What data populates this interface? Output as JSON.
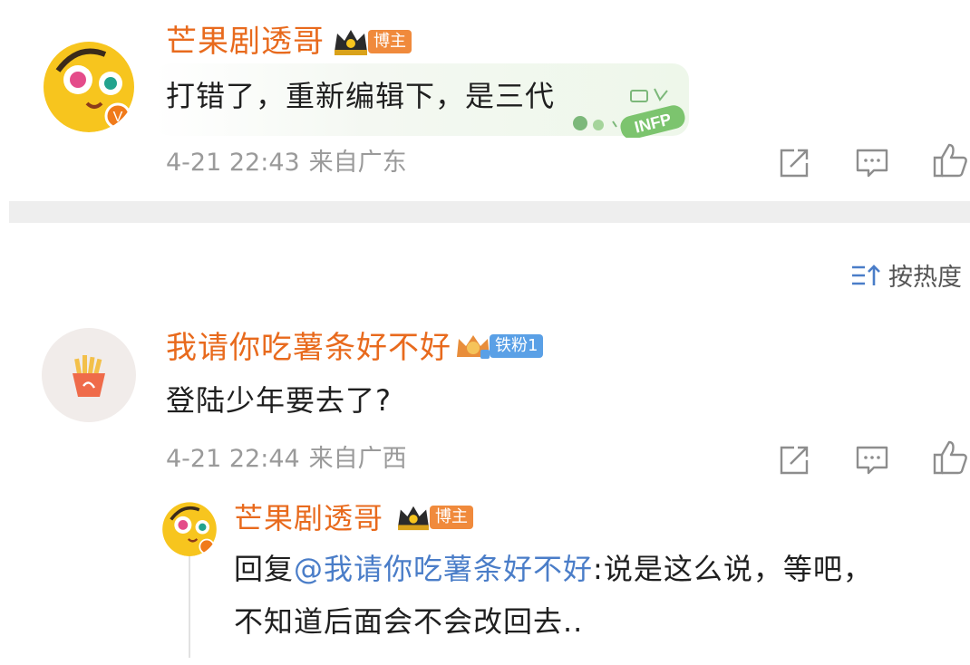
{
  "comment1": {
    "username": "芒果剧透哥",
    "badge": "博主",
    "text": "打错了，重新编辑下，是三代",
    "sticker_text": "INFP",
    "date": "4-21 22:43",
    "location": "来自广东"
  },
  "sort": {
    "label": "按热度"
  },
  "comment2": {
    "username": "我请你吃薯条好不好",
    "badge": "铁粉1",
    "text": "登陆少年要去了?",
    "date": "4-21 22:44",
    "location": "来自广西"
  },
  "reply": {
    "username": "芒果剧透哥",
    "badge": "博主",
    "prefix": "回复",
    "mention": "@我请你吃薯条好不好",
    "line1_rest": ":说是这么说，等吧，",
    "line2": "不知道后面会不会改回去.."
  },
  "colors": {
    "username": "#e86a1d",
    "mention": "#4a7dc8",
    "meta": "#9a9a9a",
    "badge_boss": "#f08a3c",
    "badge_fan": "#5aa0e6"
  }
}
